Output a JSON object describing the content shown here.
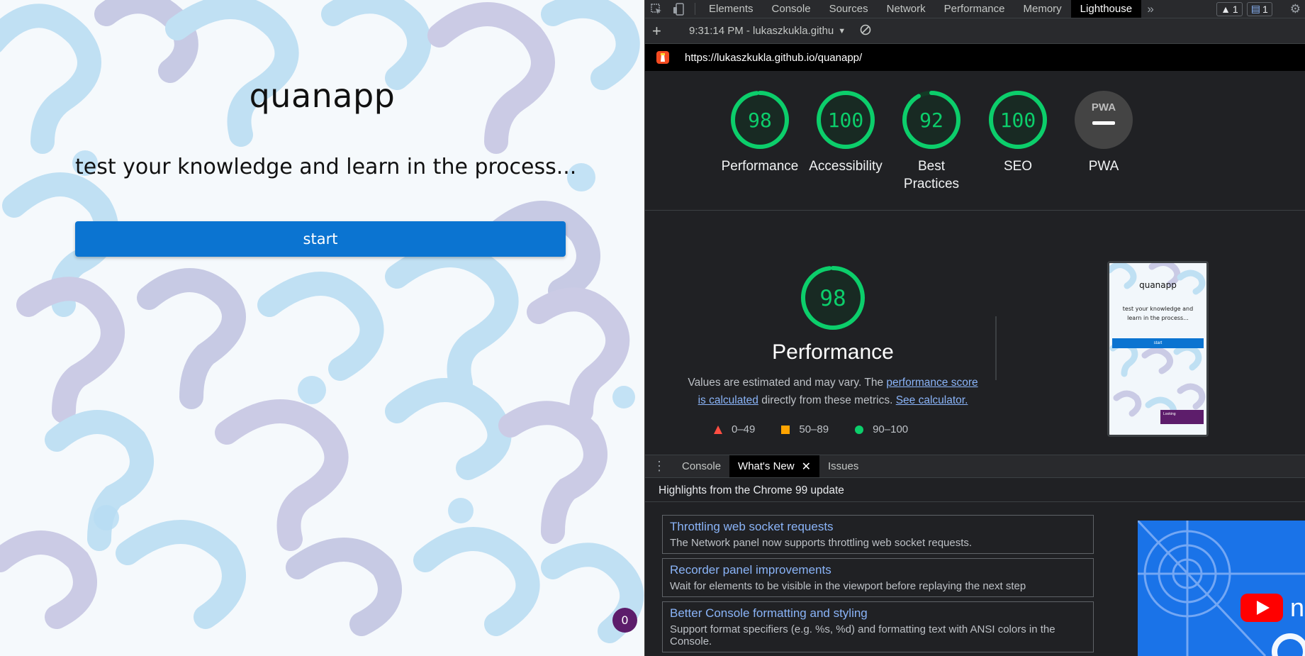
{
  "app": {
    "title": "quanapp",
    "subtitle": "test your knowledge and learn in the process...",
    "start_label": "start",
    "counter": "0",
    "colors": {
      "button": "#0b74d1",
      "badge": "#5d1d6b"
    }
  },
  "devtools": {
    "tabs": [
      "Elements",
      "Console",
      "Sources",
      "Network",
      "Performance",
      "Memory",
      "Lighthouse"
    ],
    "active_tab": "Lighthouse",
    "more_tabs_icon": "double-chevron-icon",
    "warnings_count": "1",
    "messages_count": "1",
    "toolbar": {
      "report_select": "9:31:14 PM - lukaszkukla.githu"
    },
    "url": "https://lukaszkukla.github.io/quanapp/",
    "scores": [
      {
        "label": "Performance",
        "value": "98",
        "score": 98
      },
      {
        "label": "Accessibility",
        "value": "100",
        "score": 100
      },
      {
        "label": "Best Practices",
        "value": "92",
        "score": 92
      },
      {
        "label": "SEO",
        "value": "100",
        "score": 100
      },
      {
        "label": "PWA",
        "value": "PWA",
        "score": null
      }
    ],
    "performance": {
      "score": "98",
      "title": "Performance",
      "desc_prefix": "Values are estimated and may vary. The ",
      "desc_link1": "performance score is calculated",
      "desc_middle": " directly from these metrics. ",
      "desc_link2": "See calculator.",
      "legend": [
        "0–49",
        "50–89",
        "90–100"
      ],
      "colors": {
        "fail": "#ff4e42",
        "average": "#ffa400",
        "pass": "#0cce6b"
      }
    },
    "thumbnail": {
      "title": "quanapp",
      "subtitle": "test your knowledge and learn in the process...",
      "button": "start",
      "status": "Looking"
    },
    "drawer": {
      "tabs": [
        "Console",
        "What's New",
        "Issues"
      ],
      "active": "What's New",
      "highlights": "Highlights from the Chrome 99 update",
      "items": [
        {
          "title": "Throttling web socket requests",
          "desc": "The Network panel now supports throttling web socket requests."
        },
        {
          "title": "Recorder panel improvements",
          "desc": "Wait for elements to be visible in the viewport before replaying the next step"
        },
        {
          "title": "Better Console formatting and styling",
          "desc": "Support format specifiers (e.g. %s, %d) and formatting text with ANSI colors in the Console."
        }
      ]
    }
  }
}
